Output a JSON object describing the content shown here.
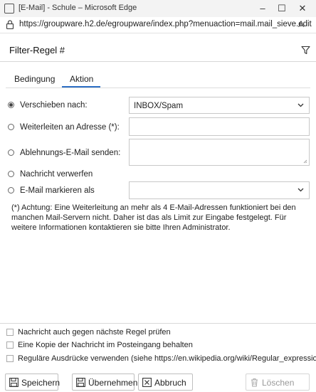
{
  "window": {
    "title": "[E-Mail] - Schule – Microsoft Edge",
    "minimize": "–",
    "maximize": "☐",
    "close": "✕"
  },
  "address": {
    "url": "https://groupware.h2.de/egroupware/index.php?menuaction=mail.mail_sieve.edit",
    "reader_icon": "A"
  },
  "dialog": {
    "title": "Filter-Regel #"
  },
  "tabs": [
    {
      "label": "Bedingung",
      "active": false
    },
    {
      "label": "Aktion",
      "active": true
    }
  ],
  "actions": {
    "move": {
      "label": "Verschieben nach:",
      "checked": true,
      "value": "INBOX/Spam"
    },
    "forward": {
      "label": "Weiterleiten an Adresse (*):",
      "checked": false,
      "value": ""
    },
    "reject": {
      "label": "Ablehnungs-E-Mail senden:",
      "checked": false,
      "value": ""
    },
    "discard": {
      "label": "Nachricht verwerfen",
      "checked": false
    },
    "flag": {
      "label": "E-Mail markieren als",
      "checked": false,
      "value": ""
    }
  },
  "note": "(*) Achtung: Eine Weiterleitung an mehr als 4 E-Mail-Adressen funktioniert bei den manchen Mail-Servern nicht. Daher ist das als Limit zur Eingabe festgelegt. Für weitere Informationen kontaktieren sie bitte Ihren Administrator.",
  "options": [
    {
      "label": "Nachricht auch gegen nächste Regel prüfen",
      "checked": false
    },
    {
      "label": "Eine Kopie der Nachricht im Posteingang behalten",
      "checked": false
    },
    {
      "label": "Reguläre Ausdrücke verwenden (siehe https://en.wikipedia.org/wiki/Regular_expression)",
      "checked": false
    }
  ],
  "buttons": {
    "save": "Speichern",
    "apply": "Übernehmen",
    "cancel": "Abbruch",
    "delete": "Löschen"
  },
  "colors": {
    "accent": "#2d6fc5",
    "border": "#c8c8c8",
    "disabled": "#999999"
  }
}
